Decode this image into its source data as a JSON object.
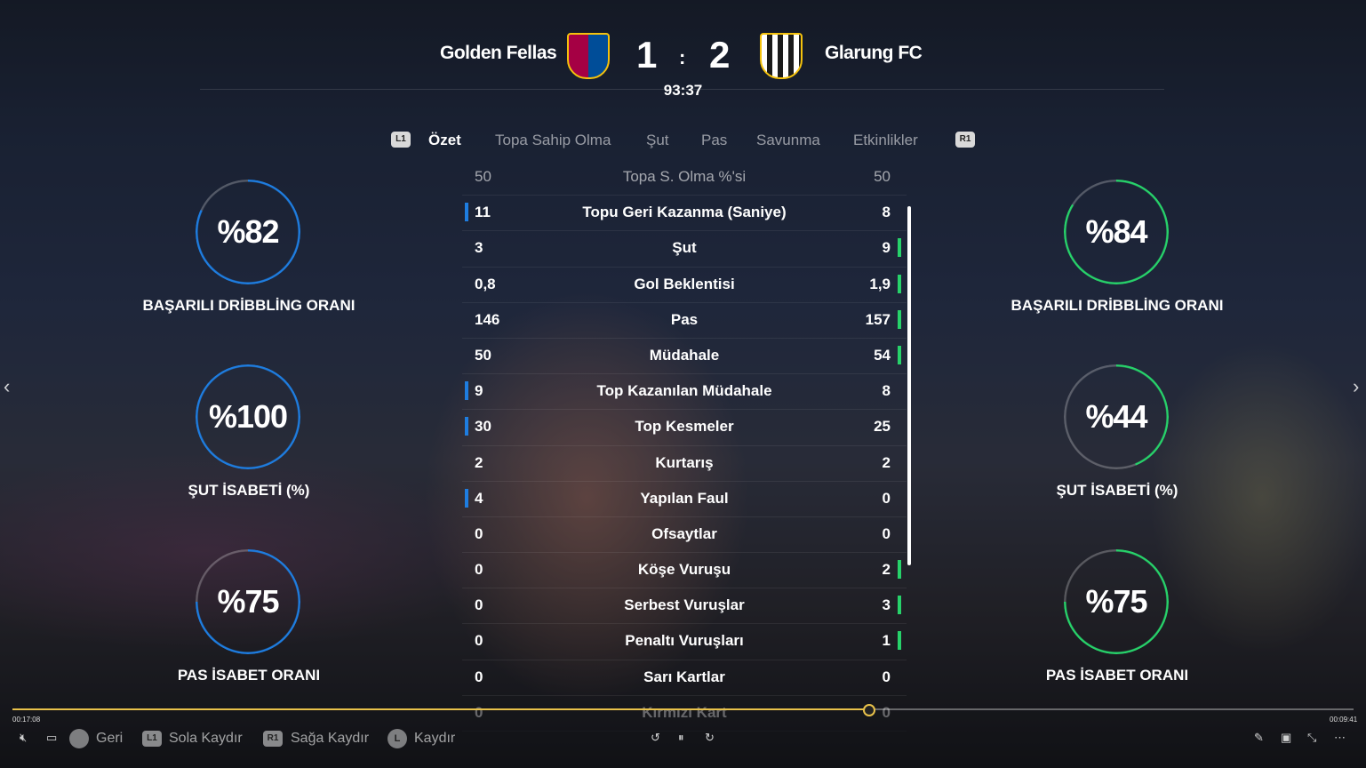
{
  "match": {
    "home_team": "Golden Fellas",
    "away_team": "Glarung FC",
    "home_score": "1",
    "separator": ":",
    "away_score": "2",
    "clock": "93:37"
  },
  "tabs": {
    "left_button": "L1",
    "right_button": "R1",
    "items": [
      "Özet",
      "Topa Sahip Olma",
      "Şut",
      "Pas",
      "Savunma",
      "Etkinlikler"
    ],
    "active": "Özet"
  },
  "stats": [
    {
      "label": "Topa S. Olma %'si",
      "home": "50",
      "away": "50",
      "lead": "none"
    },
    {
      "label": "Topu Geri Kazanma (Saniye)",
      "home": "11",
      "away": "8",
      "lead": "home"
    },
    {
      "label": "Şut",
      "home": "3",
      "away": "9",
      "lead": "away"
    },
    {
      "label": "Gol Beklentisi",
      "home": "0,8",
      "away": "1,9",
      "lead": "away"
    },
    {
      "label": "Pas",
      "home": "146",
      "away": "157",
      "lead": "away"
    },
    {
      "label": "Müdahale",
      "home": "50",
      "away": "54",
      "lead": "away"
    },
    {
      "label": "Top Kazanılan Müdahale",
      "home": "9",
      "away": "8",
      "lead": "home"
    },
    {
      "label": "Top Kesmeler",
      "home": "30",
      "away": "25",
      "lead": "home"
    },
    {
      "label": "Kurtarış",
      "home": "2",
      "away": "2",
      "lead": "none"
    },
    {
      "label": "Yapılan Faul",
      "home": "4",
      "away": "0",
      "lead": "home"
    },
    {
      "label": "Ofsaytlar",
      "home": "0",
      "away": "0",
      "lead": "none"
    },
    {
      "label": "Köşe Vuruşu",
      "home": "0",
      "away": "2",
      "lead": "away"
    },
    {
      "label": "Serbest Vuruşlar",
      "home": "0",
      "away": "3",
      "lead": "away"
    },
    {
      "label": "Penaltı Vuruşları",
      "home": "0",
      "away": "1",
      "lead": "away"
    },
    {
      "label": "Sarı Kartlar",
      "home": "0",
      "away": "0",
      "lead": "none"
    },
    {
      "label": "Kırmızı Kart",
      "home": "0",
      "away": "0",
      "lead": "none"
    }
  ],
  "rings": {
    "home": [
      {
        "value": "%82",
        "fraction": 0.82,
        "label": "BAŞARILI DRİBBLİNG ORANI"
      },
      {
        "value": "%100",
        "fraction": 1.0,
        "label": "ŞUT İSABETİ (%)"
      },
      {
        "value": "%75",
        "fraction": 0.75,
        "label": "PAS İSABET ORANI"
      }
    ],
    "away": [
      {
        "value": "%84",
        "fraction": 0.84,
        "label": "BAŞARILI DRİBBLİNG ORANI"
      },
      {
        "value": "%44",
        "fraction": 0.44,
        "label": "ŞUT İSABETİ (%)"
      },
      {
        "value": "%75",
        "fraction": 0.75,
        "label": "PAS İSABET ORANI"
      }
    ]
  },
  "colors": {
    "home": "#1e7de0",
    "away": "#27d26a",
    "progress": "#e8c14a"
  },
  "player": {
    "elapsed": "00:17:08",
    "remaining": "00:09:41",
    "progress_fraction": 0.639,
    "controls": {
      "back": "Geri",
      "left_label": "Sola Kaydır",
      "left_button": "L1",
      "right_label": "Sağa Kaydır",
      "right_button": "R1",
      "stick_label": "Kaydır",
      "stick_button": "L"
    }
  }
}
